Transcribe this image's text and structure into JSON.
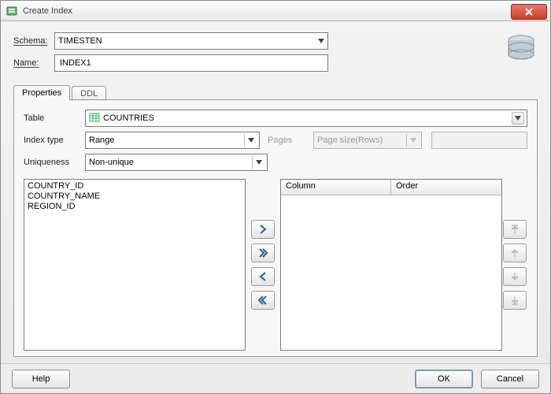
{
  "window": {
    "title": "Create Index"
  },
  "form": {
    "schema_label": "Schema:",
    "schema_value": "TIMESTEN",
    "name_label": "Name:",
    "name_value": "INDEX1"
  },
  "tabs": {
    "properties": "Properties",
    "ddl": "DDL"
  },
  "properties": {
    "table_label": "Table",
    "table_value": "COUNTRIES",
    "index_type_label": "Index type",
    "index_type_value": "Range",
    "pages_label": "Pages",
    "page_size_value": "Page size(Rows)",
    "uniqueness_label": "Uniqueness",
    "uniqueness_value": "Non-unique",
    "available_columns": [
      "COUNTRY_ID",
      "COUNTRY_NAME",
      "REGION_ID"
    ],
    "grid": {
      "column_header": "Column",
      "order_header": "Order"
    }
  },
  "buttons": {
    "help": "Help",
    "ok": "OK",
    "cancel": "Cancel"
  }
}
